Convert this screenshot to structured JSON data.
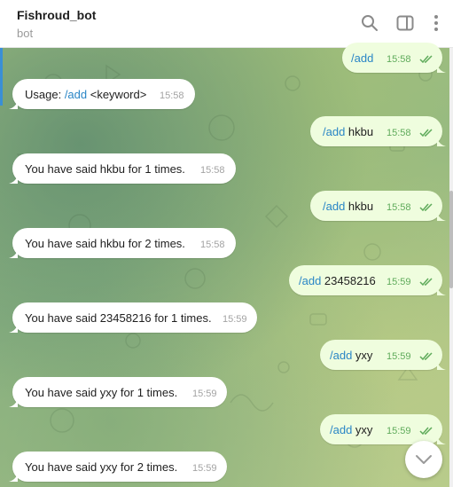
{
  "header": {
    "title": "Fishroud_bot",
    "subtitle": "bot",
    "icons": [
      "search-icon",
      "sidebar-panel-icon",
      "more-vertical-icon"
    ]
  },
  "messages": [
    {
      "dir": "out",
      "cmd": "/add",
      "arg": "",
      "time": "15:58"
    },
    {
      "dir": "in",
      "prefix": "Usage: ",
      "cmd": "/add",
      "suffix": " <keyword>",
      "time": "15:58"
    },
    {
      "dir": "out",
      "cmd": "/add",
      "arg": " hkbu",
      "time": "15:58"
    },
    {
      "dir": "in",
      "text": "You have said hkbu for 1 times.",
      "time": "15:58"
    },
    {
      "dir": "out",
      "cmd": "/add",
      "arg": " hkbu",
      "time": "15:58"
    },
    {
      "dir": "in",
      "text": "You have said hkbu for 2 times.",
      "time": "15:58"
    },
    {
      "dir": "out",
      "cmd": "/add",
      "arg": " 23458216",
      "time": "15:59"
    },
    {
      "dir": "in",
      "text": "You have said 23458216 for 1 times.",
      "time": "15:59"
    },
    {
      "dir": "out",
      "cmd": "/add",
      "arg": " yxy",
      "time": "15:59"
    },
    {
      "dir": "in",
      "text": "You have said yxy for 1 times.",
      "time": "15:59"
    },
    {
      "dir": "out",
      "cmd": "/add",
      "arg": " yxy",
      "time": "15:59"
    },
    {
      "dir": "in",
      "text": "You have said yxy for 2 times.",
      "time": "15:59"
    }
  ],
  "colors": {
    "incoming_bubble": "#ffffff",
    "outgoing_bubble": "#effdde",
    "command_link": "#2a86c6",
    "read_checks": "#5fab5b"
  },
  "scroll_down_button": "chevron-down-icon"
}
